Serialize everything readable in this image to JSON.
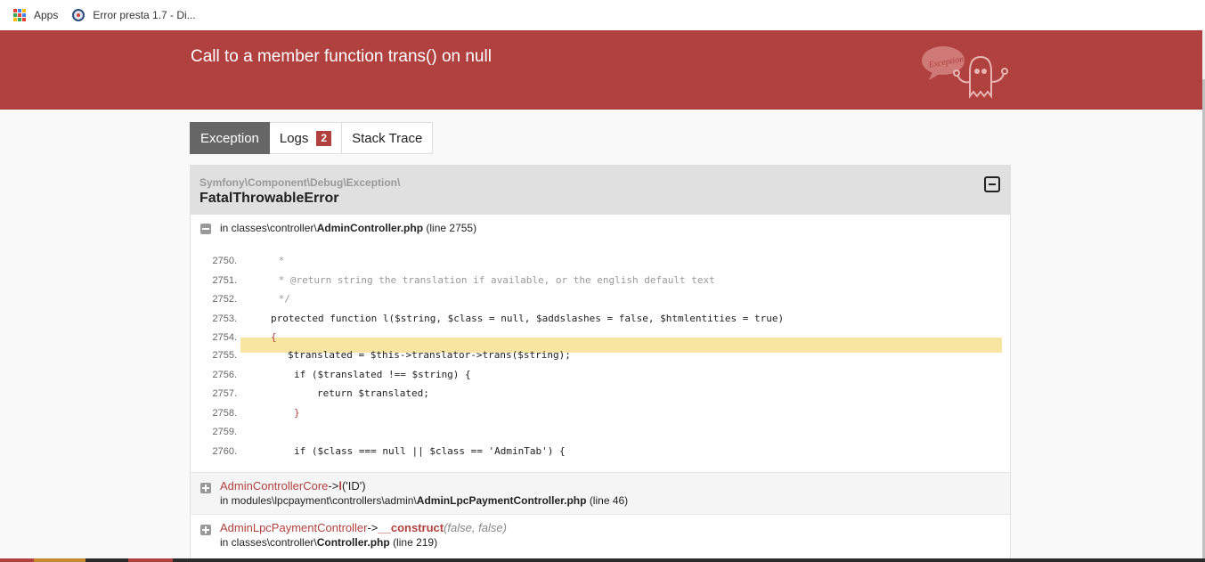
{
  "bookmarks": {
    "apps_label": "Apps",
    "tab_label": "Error presta 1.7 - Di..."
  },
  "header": {
    "title": "Call to a member function trans() on null",
    "bubble_text": "Exception!"
  },
  "tabs": [
    {
      "label": "Exception",
      "active": true
    },
    {
      "label": "Logs",
      "badge": "2"
    },
    {
      "label": "Stack Trace"
    }
  ],
  "exception": {
    "namespace": "Symfony\\Component\\Debug\\Exception\\",
    "class": "FatalThrowableError",
    "file_prefix": "in classes\\controller\\",
    "file_name": "AdminController.php",
    "file_line": "(line 2755)"
  },
  "code": {
    "lines": [
      {
        "num": "2750.",
        "text": " *"
      },
      {
        "num": "2751.",
        "text": " * @return string the translation if available, or the english default text"
      },
      {
        "num": "2752.",
        "text": " */"
      },
      {
        "num": "2753.",
        "text": "protected function l($string, $class = null, $addslashes = false, $htmlentities = true)"
      },
      {
        "num": "2754.",
        "text": "{"
      },
      {
        "num": "2755.",
        "text": "$translated = $this->translator->trans($string);"
      },
      {
        "num": "2756.",
        "text": "if ($translated !== $string) {"
      },
      {
        "num": "2757.",
        "text": "return $translated;"
      },
      {
        "num": "2758.",
        "text": "}"
      },
      {
        "num": "2759.",
        "text": ""
      },
      {
        "num": "2760.",
        "text": "if ($class === null || $class == 'AdminTab') {"
      }
    ]
  },
  "trace": [
    {
      "class": "AdminControllerCore",
      "arrow": "->",
      "method": "l",
      "args": "('ID')",
      "loc_prefix": "in modules\\lpcpayment\\controllers\\admin\\",
      "loc_file": "AdminLpcPaymentController.php",
      "loc_line": "(line 46)"
    },
    {
      "class": "AdminLpcPaymentController",
      "arrow": "->",
      "method": "__construct",
      "args": "(false, false)",
      "loc_prefix": "in classes\\controller\\",
      "loc_file": "Controller.php",
      "loc_line": "(line 219)"
    }
  ],
  "colors": {
    "header_red": "#b0413e",
    "highlight": "#f7e5a1",
    "active_tab": "#666666"
  }
}
